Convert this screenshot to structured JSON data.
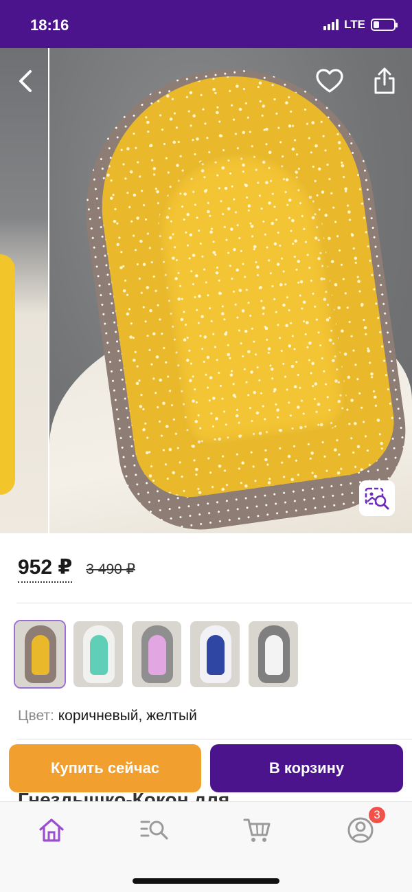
{
  "status_bar": {
    "time": "18:16",
    "network": "LTE"
  },
  "gallery": {
    "back_icon": "chevron-left-icon",
    "favorite_icon": "heart-icon",
    "share_icon": "share-icon",
    "image_search_icon": "image-search-icon"
  },
  "product": {
    "price": "952 ₽",
    "old_price": "3 490 ₽",
    "color_label": "Цвет:",
    "color_value": "коричневый, желтый",
    "title_partial": "Гнездышко-Кокон для"
  },
  "variants": [
    {
      "name": "brown-yellow",
      "outer": "#8d7d74",
      "inner": "#eab82b",
      "selected": true
    },
    {
      "name": "mint-white",
      "outer": "#f1f1ef",
      "inner": "#5fd0b7",
      "selected": false
    },
    {
      "name": "pink-grey",
      "outer": "#8f8f8f",
      "inner": "#e2a7e3",
      "selected": false
    },
    {
      "name": "blue-white",
      "outer": "#f2f2f6",
      "inner": "#2f47a3",
      "selected": false
    },
    {
      "name": "grey-white",
      "outer": "#7f7f80",
      "inner": "#f3f3f3",
      "selected": false
    }
  ],
  "actions": {
    "buy_now": "Купить сейчас",
    "add_to_cart": "В корзину"
  },
  "tab_bar": {
    "items": [
      "home-icon",
      "catalog-search-icon",
      "cart-icon",
      "profile-icon"
    ],
    "profile_badge": "3"
  },
  "colors": {
    "brand_purple": "#4b148c",
    "buy_orange": "#f19f2e",
    "badge_red": "#f2514a",
    "home_active": "#9b4fd0"
  }
}
